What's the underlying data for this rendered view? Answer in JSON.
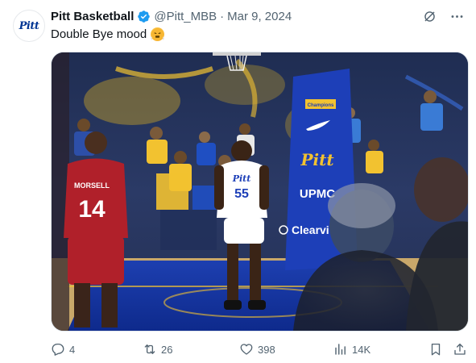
{
  "author": {
    "name": "Pitt Basketball",
    "handle": "@Pitt_MBB",
    "separator": "·",
    "date": "Mar 9, 2024",
    "avatar_text": "Pitt"
  },
  "tweet": {
    "text": "Double Bye mood",
    "emoji": "steaming-face-emoji"
  },
  "media": {
    "jersey_back_name": "MORSELL",
    "jersey_back_number": "14",
    "jersey_front_team": "Pitt",
    "jersey_front_number": "55",
    "stanchion_team": "Pitt",
    "stanchion_sponsor": "UPMC",
    "stanchion_sponsor2": "Clearvi",
    "scoreboard_text": "Champions"
  },
  "metrics": {
    "replies": "4",
    "reposts": "26",
    "likes": "398",
    "views": "14K"
  },
  "colors": {
    "verified": "#1d9bf0",
    "muted": "#536471",
    "pitt_blue": "#003594",
    "pitt_gold": "#ffb81c"
  }
}
